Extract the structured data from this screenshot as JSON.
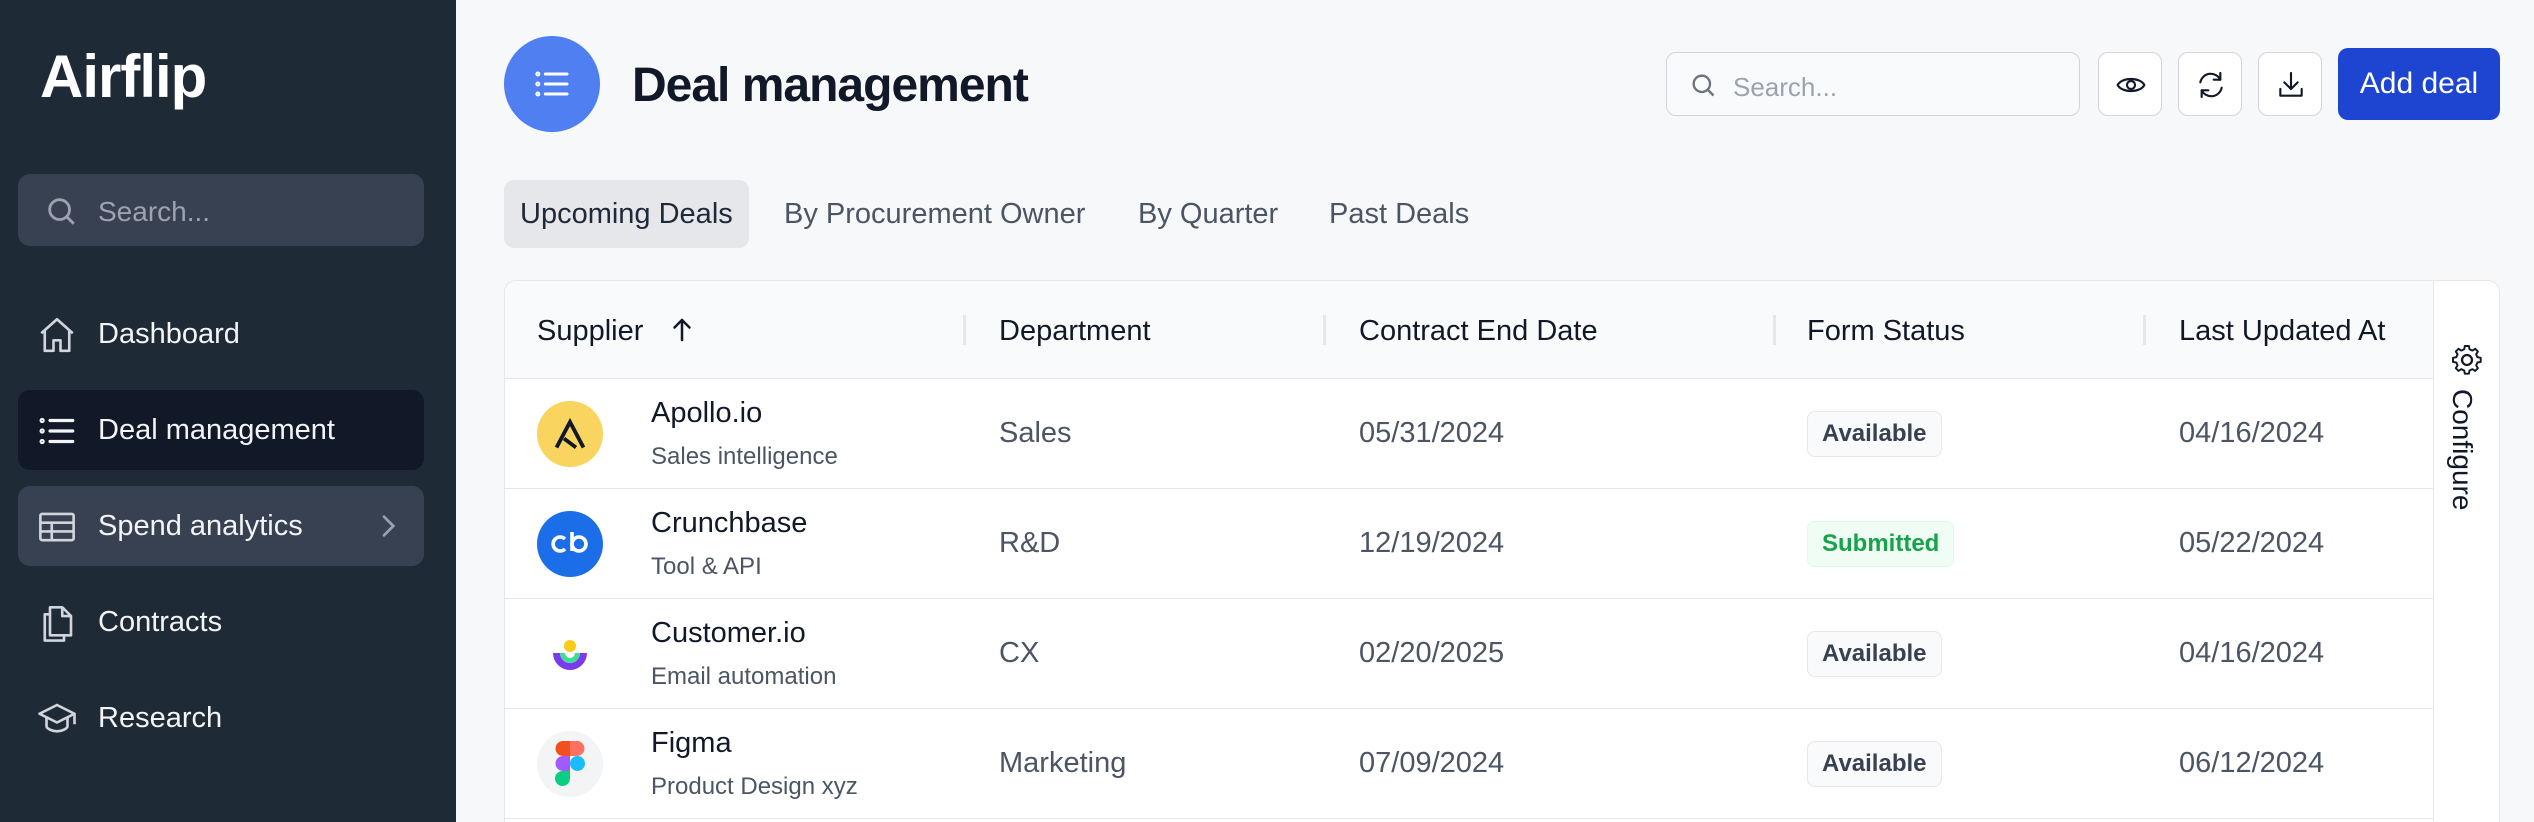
{
  "app": {
    "brand": "Airflip"
  },
  "sidebar": {
    "search_placeholder": "Search...",
    "items": [
      {
        "label": "Dashboard",
        "icon": "home-icon"
      },
      {
        "label": "Deal management",
        "icon": "list-icon",
        "active": true
      },
      {
        "label": "Spend analytics",
        "icon": "table-icon",
        "has_children": true
      },
      {
        "label": "Contracts",
        "icon": "documents-icon"
      },
      {
        "label": "Research",
        "icon": "academic-cap-icon"
      }
    ]
  },
  "header": {
    "title": "Deal management",
    "search_placeholder": "Search...",
    "add_button": "Add deal"
  },
  "tabs": [
    {
      "label": "Upcoming Deals",
      "active": true
    },
    {
      "label": "By Procurement Owner"
    },
    {
      "label": "By Quarter"
    },
    {
      "label": "Past Deals"
    }
  ],
  "table": {
    "columns": [
      "Supplier",
      "Department",
      "Contract End Date",
      "Form Status",
      "Last Updated At"
    ],
    "sort": {
      "column": "Supplier",
      "direction": "ascending"
    },
    "rows": [
      {
        "supplier": "Apollo.io",
        "subtitle": "Sales intelligence",
        "department": "Sales",
        "end_date": "05/31/2024",
        "status": "Available",
        "updated": "04/16/2024"
      },
      {
        "supplier": "Crunchbase",
        "subtitle": "Tool & API",
        "department": "R&D",
        "end_date": "12/19/2024",
        "status": "Submitted",
        "updated": "05/22/2024"
      },
      {
        "supplier": "Customer.io",
        "subtitle": "Email automation",
        "department": "CX",
        "end_date": "02/20/2025",
        "status": "Available",
        "updated": "04/16/2024"
      },
      {
        "supplier": "Figma",
        "subtitle": "Product Design xyz",
        "department": "Marketing",
        "end_date": "07/09/2024",
        "status": "Available",
        "updated": "06/12/2024"
      }
    ],
    "configure_label": "Configure"
  },
  "colors": {
    "sidebar_bg": "#1f2a37",
    "accent": "#1d45d1",
    "header_icon_bg": "#4f7ff0",
    "submitted_green": "#16a34a"
  }
}
